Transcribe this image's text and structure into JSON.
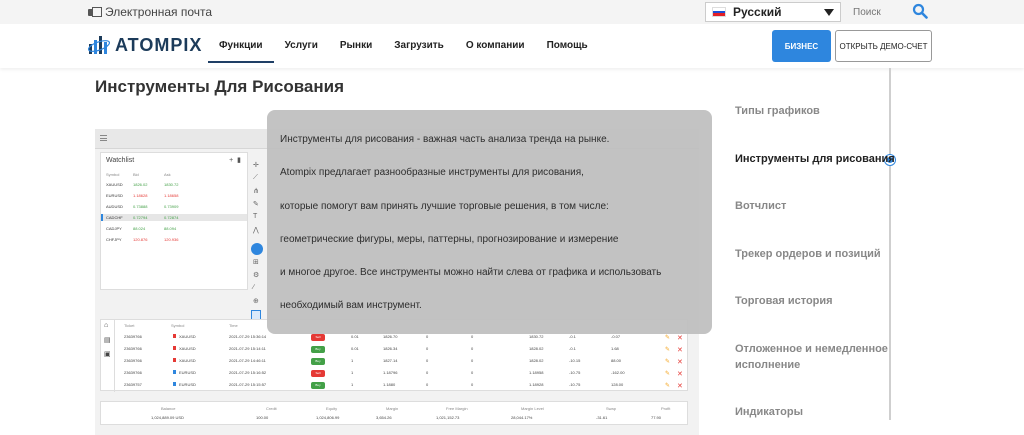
{
  "topbar": {
    "email_label": "Электронная почта",
    "language": "Русский",
    "search_placeholder": "Поиск"
  },
  "nav": {
    "logo_text": "ATOMPIX",
    "items": [
      {
        "label": "Функции",
        "active": true
      },
      {
        "label": "Услуги",
        "active": false
      },
      {
        "label": "Рынки",
        "active": false
      },
      {
        "label": "Загрузить",
        "active": false
      },
      {
        "label": "О компании",
        "active": false
      },
      {
        "label": "Помощь",
        "active": false
      }
    ],
    "business_button": "БИЗНЕС",
    "demo_button": "ОТКРЫТЬ ДЕМО-СЧЕТ",
    "accent_color": "#2e86de",
    "brand_color": "#1c3b5a"
  },
  "page": {
    "title": "Инструменты Для Рисования"
  },
  "overlay": {
    "lines": [
      "Инструменты для рисования - важная часть анализа тренда на рынке.",
      "Atompix предлагает разнообразные инструменты для рисования,",
      "которые помогут вам принять лучшие торговые решения, в том числе:",
      "геометрические фигуры, меры, паттерны, прогнозирование и измерение",
      "и многое другое. Все инструменты можно найти слева от графика и использовать",
      "необходимый вам инструмент."
    ]
  },
  "sections": [
    {
      "label": "Типы графиков",
      "active": false
    },
    {
      "label": "Инструменты для рисования",
      "active": true
    },
    {
      "label": "Вотчлист",
      "active": false
    },
    {
      "label": "Трекер ордеров и позиций",
      "active": false
    },
    {
      "label": "Торговая история",
      "active": false
    },
    {
      "label": "Отложенное и немедленное",
      "active": false
    },
    {
      "label": "исполнение",
      "active": false
    },
    {
      "label": "Индикаторы",
      "active": false
    }
  ],
  "platform": {
    "watchlist": {
      "title": "Watchlist",
      "headers": [
        "Symbol",
        "Bid",
        "Ask"
      ],
      "rows": [
        {
          "symbol": "XAUUSD",
          "bid": "1826.02",
          "ask": "1830.72"
        },
        {
          "symbol": "EURUSD",
          "bid": "1.18628",
          "ask": "1.18658"
        },
        {
          "symbol": "AUDUSD",
          "bid": "0.73888",
          "ask": "0.73909"
        },
        {
          "symbol": "CADCHF",
          "bid": "0.72794",
          "ask": "0.72874"
        },
        {
          "symbol": "CADJPY",
          "bid": "88.024",
          "ask": "88.094"
        },
        {
          "symbol": "CHFJPY",
          "bid": "120.876",
          "ask": "120.936"
        }
      ]
    },
    "orders": {
      "headers": [
        "Ticket",
        "Symbol",
        "Time"
      ],
      "rows": [
        {
          "ticket": "23639766",
          "symbol": "XAUUSD",
          "time": "2021-07-29 15:36:14",
          "dir": "Sell",
          "vol": "0.01",
          "price": "1826.70",
          "v1": "0",
          "v2": "0",
          "cur": "1830.72",
          "sw": "-0.1",
          "pl": "-0.07"
        },
        {
          "ticket": "23639766",
          "symbol": "XAUUSD",
          "time": "2021-07-29 15:14:11",
          "dir": "Buy",
          "vol": "0.01",
          "price": "1826.34",
          "v1": "0",
          "v2": "0",
          "cur": "1828.02",
          "sw": "-0.1",
          "pl": "1.68"
        },
        {
          "ticket": "23639766",
          "symbol": "XAUUSD",
          "time": "2021-07-29 14:46:11",
          "dir": "Buy",
          "vol": "1",
          "price": "1827.14",
          "v1": "0",
          "v2": "0",
          "cur": "1828.02",
          "sw": "-10.15",
          "pl": "88.00"
        },
        {
          "ticket": "23639766",
          "symbol": "EURUSD",
          "time": "2021-07-29 15:16:52",
          "dir": "Sell",
          "vol": "1",
          "price": "1.18796",
          "v1": "0",
          "v2": "0",
          "cur": "1.18958",
          "sw": "-10.75",
          "pl": "-162.00"
        },
        {
          "ticket": "23639757",
          "symbol": "EURUSD",
          "time": "2021-07-29 15:15:57",
          "dir": "Buy",
          "vol": "1",
          "price": "1.1880",
          "v1": "0",
          "v2": "0",
          "cur": "1.18928",
          "sw": "-10.75",
          "pl": "128.00"
        }
      ]
    },
    "summary": {
      "labels": [
        "Balance",
        "Credit",
        "Equity",
        "Margin",
        "Free Margin",
        "Margin Level",
        "Swap",
        "Profit"
      ],
      "values": [
        "1,024,889.09 USD",
        "100.00",
        "1,024,806.99",
        "3,654.26",
        "1,021,152.73",
        "28,044.17%",
        "-31.61",
        "77.90"
      ]
    }
  }
}
